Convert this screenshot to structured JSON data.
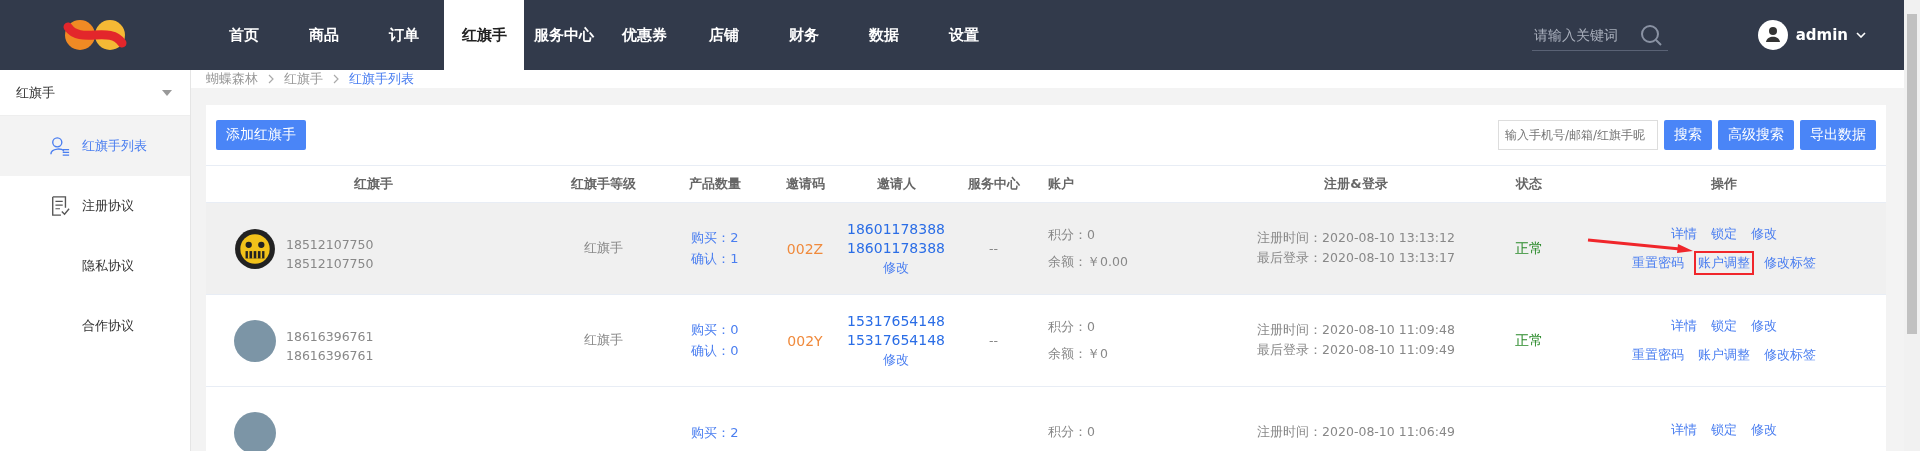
{
  "nav": {
    "items": [
      {
        "label": "首页",
        "selected": false
      },
      {
        "label": "商品",
        "selected": false
      },
      {
        "label": "订单",
        "selected": false
      },
      {
        "label": "红旗手",
        "selected": true
      },
      {
        "label": "服务中心",
        "selected": false
      },
      {
        "label": "优惠券",
        "selected": false
      },
      {
        "label": "店铺",
        "selected": false
      },
      {
        "label": "财务",
        "selected": false
      },
      {
        "label": "数据",
        "selected": false
      },
      {
        "label": "设置",
        "selected": false
      }
    ],
    "search": {
      "placeholder": "请输入关键词"
    },
    "user": "admin"
  },
  "sidebar": {
    "title": "红旗手",
    "items": [
      {
        "label": "红旗手列表",
        "selected": true,
        "has_icon": true
      },
      {
        "label": "注册协议",
        "selected": false,
        "has_icon": true
      },
      {
        "label": "隐私协议",
        "selected": false,
        "has_icon": false
      },
      {
        "label": "合作协议",
        "selected": false,
        "has_icon": false
      }
    ]
  },
  "breadcrumb": [
    {
      "label": "蝴蝶森林",
      "current": false
    },
    {
      "label": "红旗手",
      "current": false
    },
    {
      "label": "红旗手列表",
      "current": true
    }
  ],
  "toolbar": {
    "add_button": "添加红旗手",
    "search": {
      "placeholder": "输入手机号/邮箱/红旗手昵"
    },
    "buttons": [
      "搜索",
      "高级搜索",
      "导出数据"
    ]
  },
  "table": {
    "columns": [
      "红旗手",
      "红旗手等级",
      "产品数量",
      "邀请码",
      "邀请人",
      "服务中心",
      "账户",
      "注册&登录",
      "状态",
      "操作"
    ],
    "rows": [
      {
        "hovered": true,
        "kind": "cartoon",
        "phones": [
          "18512107750",
          "18512107750"
        ],
        "level": "红旗手",
        "products": [
          "购买：2",
          "确认：1"
        ],
        "code": "002Z",
        "inviter": [
          "18601178388",
          "18601178388"
        ],
        "inviter_edit": "修改",
        "service": "--",
        "account": [
          "积分：0",
          "余额：￥0.00"
        ],
        "times": [
          "注册时间：2020-08-10 13:13:12",
          "最后登录：2020-08-10 13:13:17"
        ],
        "status": "正常",
        "actions": [
          {
            "label": "详情",
            "highlighted": false
          },
          {
            "label": "锁定",
            "highlighted": false
          },
          {
            "label": "修改",
            "highlighted": false
          },
          {
            "label": "重置密码",
            "highlighted": false
          },
          {
            "label": "账户调整",
            "highlighted": true
          },
          {
            "label": "修改标签",
            "highlighted": false
          }
        ]
      },
      {
        "hovered": false,
        "kind": "photo",
        "phones": [
          "18616396761",
          "18616396761"
        ],
        "level": "红旗手",
        "products": [
          "购买：0",
          "确认：0"
        ],
        "code": "002Y",
        "inviter": [
          "15317654148",
          "15317654148"
        ],
        "inviter_edit": "修改",
        "service": "--",
        "account": [
          "积分：0",
          "余额：￥0"
        ],
        "times": [
          "注册时间：2020-08-10 11:09:48",
          "最后登录：2020-08-10 11:09:49"
        ],
        "status": "正常",
        "actions": [
          {
            "label": "详情",
            "highlighted": false
          },
          {
            "label": "锁定",
            "highlighted": false
          },
          {
            "label": "修改",
            "highlighted": false
          },
          {
            "label": "重置密码",
            "highlighted": false
          },
          {
            "label": "账户调整",
            "highlighted": false
          },
          {
            "label": "修改标签",
            "highlighted": false
          }
        ]
      },
      {
        "hovered": false,
        "kind": "photo",
        "phones": [],
        "products": [
          "购买：2"
        ],
        "inviter": [],
        "account": [
          "积分：0"
        ],
        "times": [
          "注册时间：2020-08-10 11:06:49"
        ],
        "actions": [
          {
            "label": "详情",
            "highlighted": false
          },
          {
            "label": "锁定",
            "highlighted": false
          },
          {
            "label": "修改",
            "highlighted": false
          }
        ]
      }
    ]
  }
}
